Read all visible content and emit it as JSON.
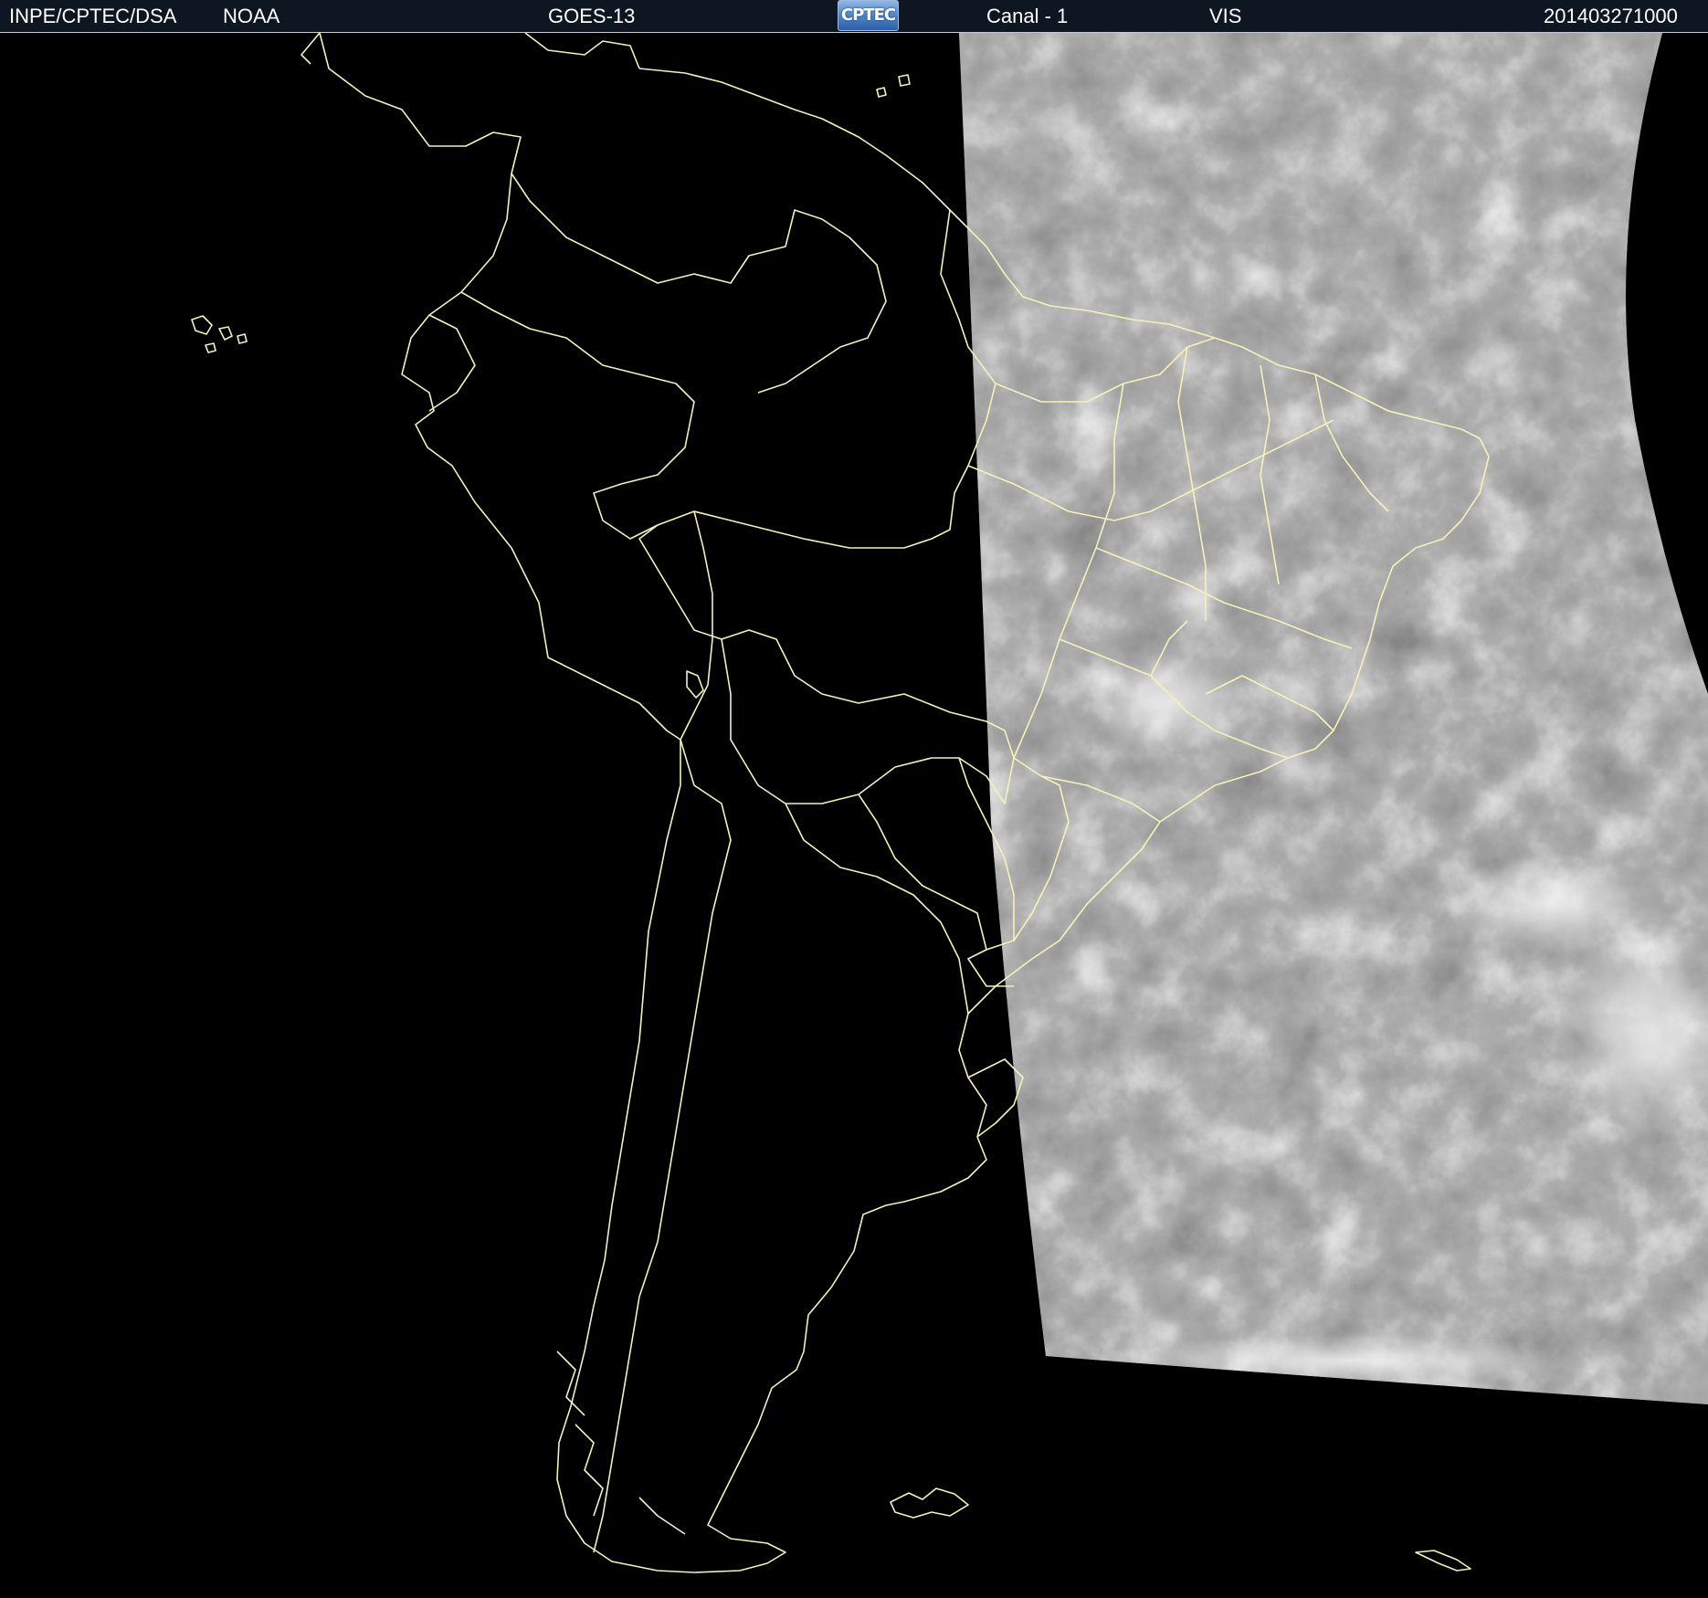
{
  "header": {
    "agency": "INPE/CPTEC/DSA",
    "source": "NOAA",
    "satellite": "GOES-13",
    "logo_text": "CPTEC",
    "channel": "Canal - 1",
    "band": "VIS",
    "datetime": "201403271000"
  },
  "colors": {
    "header_background": "#0e1622",
    "header_text": "#ffffff",
    "boundary_lines": "#f4f2b8",
    "map_background": "#000000",
    "cloud_imagery": "#8a8a8a"
  }
}
